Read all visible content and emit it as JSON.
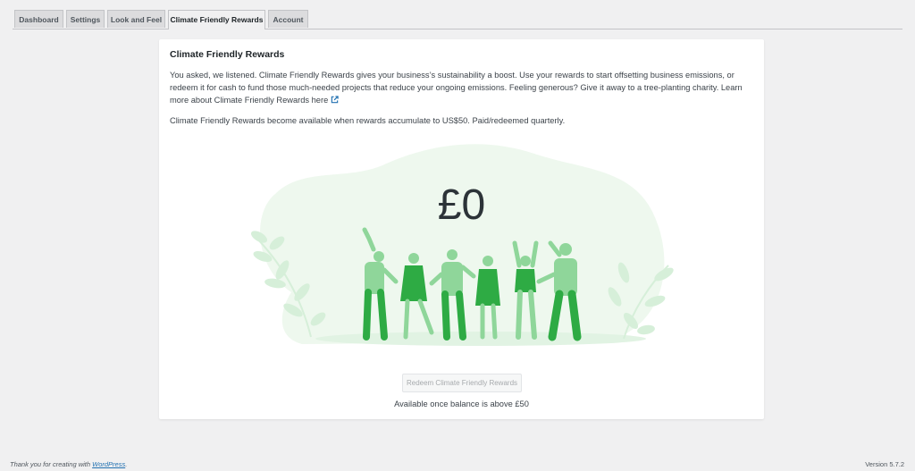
{
  "tabs": [
    {
      "label": "Dashboard",
      "active": false
    },
    {
      "label": "Settings",
      "active": false
    },
    {
      "label": "Look and Feel",
      "active": false
    },
    {
      "label": "Climate Friendly Rewards",
      "active": true
    },
    {
      "label": "Account",
      "active": false
    }
  ],
  "card": {
    "title": "Climate Friendly Rewards",
    "intro": "You asked, we listened. Climate Friendly Rewards gives your business’s sustainability a boost. Use your rewards to start offsetting business emissions, or redeem it for cash to fund those much-needed projects that reduce your ongoing emissions. Feeling generous? Give it away to a tree-planting charity. Learn more about ",
    "learn_more_link": "Climate Friendly Rewards here",
    "availability_note": "Climate Friendly Rewards become available when rewards accumulate to US$50. Paid/redeemed quarterly.",
    "balance": "£0",
    "redeem_button": "Redeem Climate Friendly Rewards",
    "redeem_note": "Available once balance is above £50"
  },
  "icons": {
    "external_link": "external-link-icon",
    "illustration": "dancing-people-illustration"
  },
  "colors": {
    "accent_green": "#2eab44",
    "light_green": "#8fd69a",
    "blob_green": "#eef8ee"
  },
  "footer": {
    "thanks_prefix": "Thank you for creating with ",
    "wordpress_link": "WordPress",
    "thanks_suffix": ".",
    "version": "Version 5.7.2"
  }
}
